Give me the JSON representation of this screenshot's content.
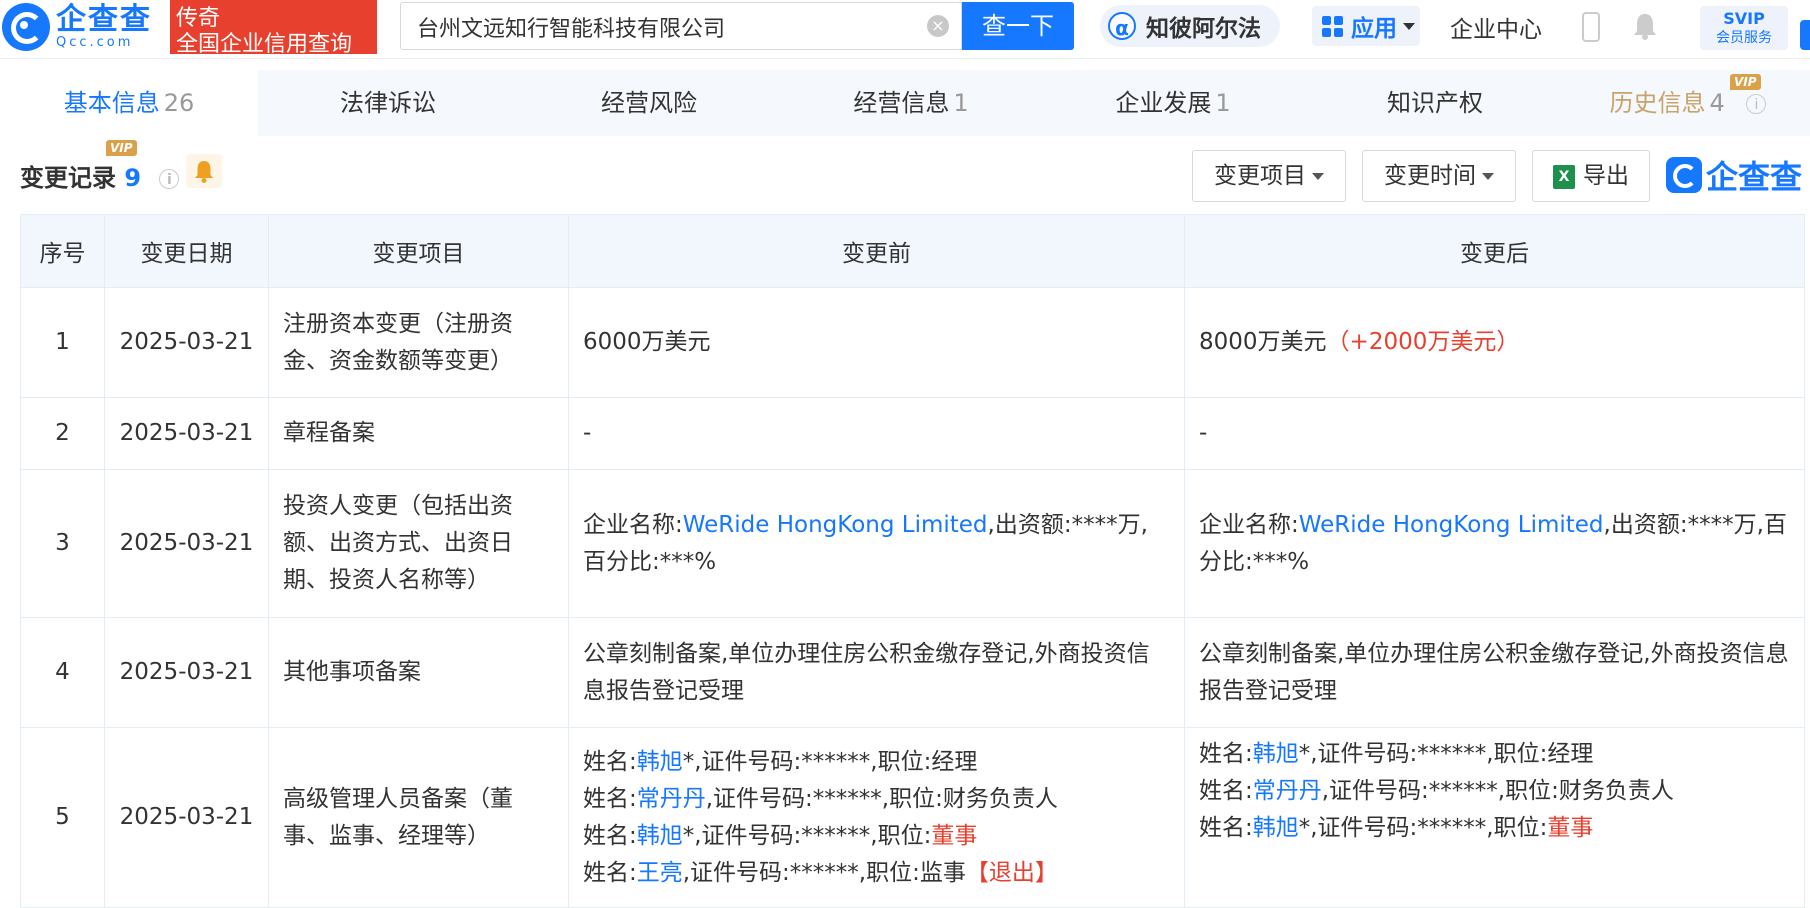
{
  "header": {
    "logo_cn": "企查查",
    "logo_en": "Qcc.com",
    "tag_line1": "传奇",
    "tag_line2": "全国企业信用查询",
    "search_value": "台州文远知行智能科技有限公司",
    "search_button": "查一下",
    "zhibi_label": "知彼阿尔法",
    "app_label": "应用",
    "enterprise_center": "企业中心",
    "svip_top": "SVIP",
    "svip_bottom": "会员服务"
  },
  "tabs": [
    {
      "label": "基本信息",
      "count": "26"
    },
    {
      "label": "法律诉讼",
      "count": ""
    },
    {
      "label": "经营风险",
      "count": ""
    },
    {
      "label": "经营信息",
      "count": "1"
    },
    {
      "label": "企业发展",
      "count": "1"
    },
    {
      "label": "知识产权",
      "count": ""
    },
    {
      "label": "历史信息",
      "count": "4"
    }
  ],
  "vip_label": "VIP",
  "section": {
    "title": "变更记录",
    "count": "9",
    "filter_item": "变更项目",
    "filter_time": "变更时间",
    "export": "导出",
    "brand": "企查查"
  },
  "table": {
    "headers": [
      "序号",
      "变更日期",
      "变更项目",
      "变更前",
      "变更后"
    ],
    "rows": [
      {
        "no": "1",
        "date": "2025-03-21",
        "item": "注册资本变更（注册资金、资金数额等变更）",
        "before": "6000万美元",
        "after": "8000万美元",
        "after_delta": "（+2000万美元）"
      },
      {
        "no": "2",
        "date": "2025-03-21",
        "item": "章程备案",
        "before": "-",
        "after": "-"
      },
      {
        "no": "3",
        "date": "2025-03-21",
        "item": "投资人变更（包括出资额、出资方式、出资日期、投资人名称等）",
        "before_prefix": "企业名称:",
        "before_link": "WeRide HongKong Limited",
        "before_suffix": ",出资额:****万,百分比:***%",
        "after_prefix": "企业名称:",
        "after_link": "WeRide HongKong Limited",
        "after_suffix": ",出资额:****万,百分比:***%"
      },
      {
        "no": "4",
        "date": "2025-03-21",
        "item": "其他事项备案",
        "before": "公章刻制备案,单位办理住房公积金缴存登记,外商投资信息报告登记受理",
        "after": "公章刻制备案,单位办理住房公积金缴存登记,外商投资信息报告登记受理"
      },
      {
        "no": "5",
        "date": "2025-03-21",
        "item": "高级管理人员备案（董事、监事、经理等）"
      }
    ],
    "row5_before": [
      {
        "pre": "姓名:",
        "name": "韩旭",
        "mid": "*,证件号码:******,职位:",
        "role": "经理",
        "role_red": false,
        "extra": ""
      },
      {
        "pre": "姓名:",
        "name": "常丹丹",
        "mid": ",证件号码:******,职位:",
        "role": "财务负责人",
        "role_red": false,
        "extra": ""
      },
      {
        "pre": "姓名:",
        "name": "韩旭",
        "mid": "*,证件号码:******,职位:",
        "role": "董事",
        "role_red": true,
        "extra": ""
      },
      {
        "pre": "姓名:",
        "name": "王亮",
        "mid": ",证件号码:******,职位:",
        "role": "监事",
        "role_red": false,
        "extra": "【退出】"
      }
    ],
    "row5_after": [
      {
        "pre": "姓名:",
        "name": "韩旭",
        "mid": "*,证件号码:******,职位:",
        "role": "经理",
        "role_red": false
      },
      {
        "pre": "姓名:",
        "name": "常丹丹",
        "mid": ",证件号码:******,职位:",
        "role": "财务负责人",
        "role_red": false
      },
      {
        "pre": "姓名:",
        "name": "韩旭",
        "mid": "*,证件号码:******,职位:",
        "role": "董事",
        "role_red": true
      }
    ]
  }
}
